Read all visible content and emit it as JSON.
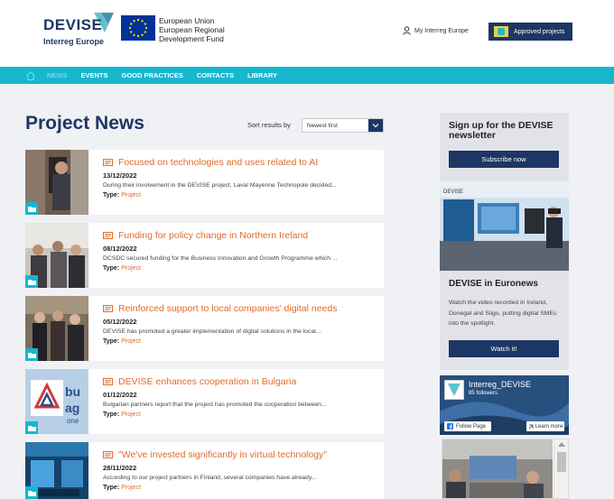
{
  "header": {
    "logo_title": "DEVISE",
    "logo_subtitle": "Interreg Europe",
    "eu_lines": [
      "European Union",
      "European Regional",
      "Development Fund"
    ],
    "my_interreg": "My Interreg Europe",
    "approved_projects": "Approved projects"
  },
  "nav": {
    "items": [
      "News",
      "Events",
      "Good practices",
      "Contacts",
      "Library"
    ],
    "active_index": 0
  },
  "main": {
    "title": "Project News",
    "sort_label": "Sort results by",
    "sort_value": "Newest first",
    "type_label": "Type:",
    "news": [
      {
        "title": "Focused on technologies and uses related to AI",
        "date": "13/12/2022",
        "excerpt": "During their involvement in the DEVISE project, Laval Mayenne Technopole decided...",
        "type": "Project"
      },
      {
        "title": "Funding for policy change in Northern Ireland",
        "date": "08/12/2022",
        "excerpt": "DCSDC secured funding for the Business Innovation and Growth Programme which ...",
        "type": "Project"
      },
      {
        "title": "Reinforced support to local companies' digital needs",
        "date": "05/12/2022",
        "excerpt": "DEVISE has promoted a greater implementation of digital solutions in the local...",
        "type": "Project"
      },
      {
        "title": "DEVISE enhances cooperation in Bulgaria",
        "date": "01/12/2022",
        "excerpt": "Bulgarian partners report that the project has promoted the cooperation between...",
        "type": "Project"
      },
      {
        "title": "\"We've invested significantly in virtual technology\"",
        "date": "28/11/2022",
        "excerpt": "According to our project partners in Finland, several companies have already...",
        "type": "Project"
      }
    ]
  },
  "sidebar": {
    "newsletter_title": "Sign up for the DEVISE newsletter",
    "subscribe_label": "Subscribe now",
    "euronews_img_label": "DEVISE",
    "euronews_title": "DEVISE in Euronews",
    "euronews_text": "Watch the video recorded in Ireland, Donegal and Sligo, putting digital SMEs into the spotlight.",
    "watch_label": "Watch it!",
    "fb_name": "Interreg_DEVISE",
    "fb_followers": "85 followers",
    "fb_follow": "Follow Page",
    "fb_learn": "Learn more"
  },
  "colors": {
    "navy": "#1d3765",
    "teal": "#16b7cf",
    "orange": "#e06b2b",
    "panel": "#e2e3e8"
  }
}
